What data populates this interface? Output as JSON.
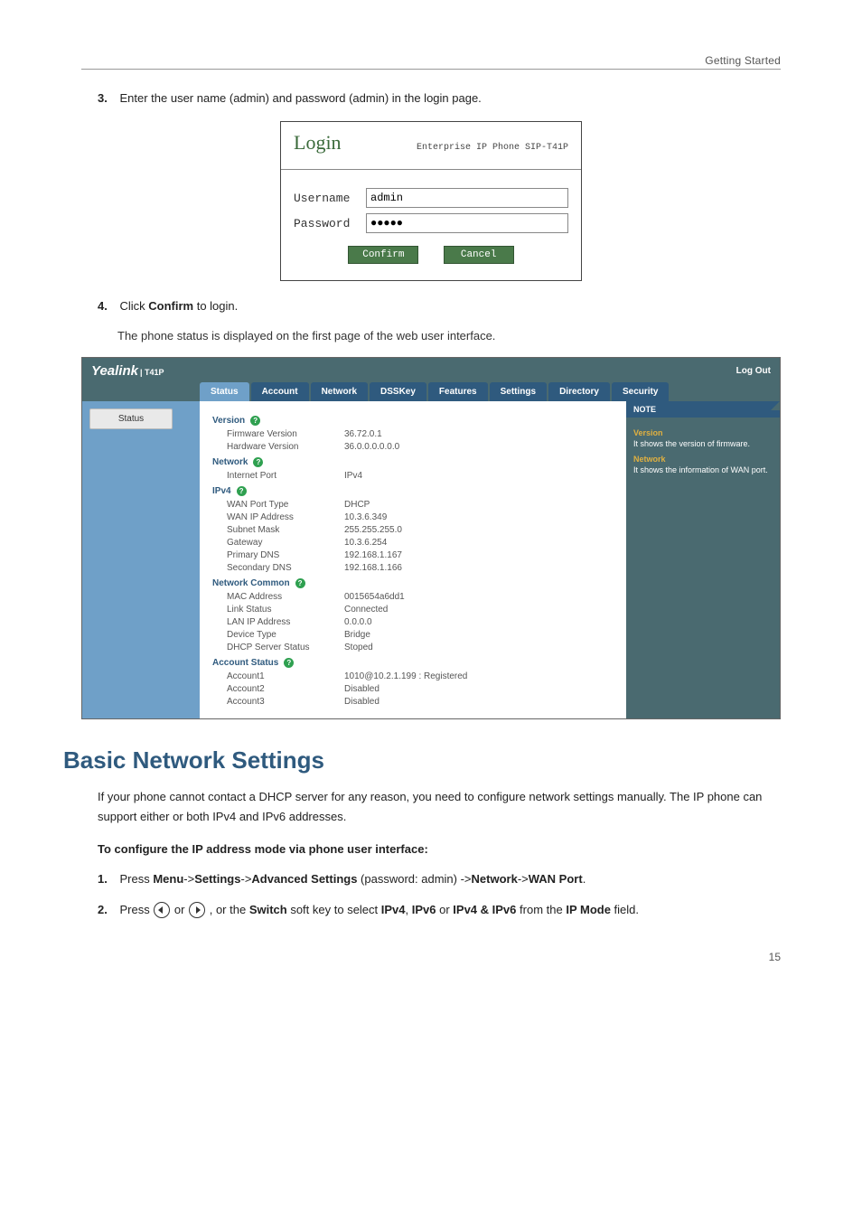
{
  "header": {
    "section": "Getting Started"
  },
  "steps": {
    "s3_num": "3.",
    "s3_text": "Enter the user name (admin) and password (admin) in the login page.",
    "s4_num": "4.",
    "s4_text_a": "Click ",
    "s4_text_b": "Confirm",
    "s4_text_c": " to login.",
    "s4_sub": "The phone status is displayed on the first page of the web user interface."
  },
  "login": {
    "title": "Login",
    "subtitle": "Enterprise IP Phone SIP-T41P",
    "username_label": "Username",
    "username_value": "admin",
    "password_label": "Password",
    "password_value": "●●●●●",
    "confirm": "Confirm",
    "cancel": "Cancel"
  },
  "webui": {
    "brand": "Yealink",
    "brand_sub": "| T41P",
    "logout": "Log Out",
    "tabs": [
      "Status",
      "Account",
      "Network",
      "DSSKey",
      "Features",
      "Settings",
      "Directory",
      "Security"
    ],
    "active_tab_index": 0,
    "side_item": "Status",
    "note_head": "NOTE",
    "notes": [
      {
        "title": "Version",
        "text": "It shows the version of firmware."
      },
      {
        "title": "Network",
        "text": "It shows the information of WAN port."
      }
    ],
    "sections": [
      {
        "title": "Version",
        "rows": [
          {
            "k": "Firmware Version",
            "v": "36.72.0.1"
          },
          {
            "k": "Hardware Version",
            "v": "36.0.0.0.0.0.0"
          }
        ]
      },
      {
        "title": "Network",
        "rows": [
          {
            "k": "Internet Port",
            "v": "IPv4"
          }
        ]
      },
      {
        "title": "IPv4",
        "rows": [
          {
            "k": "WAN Port Type",
            "v": "DHCP"
          },
          {
            "k": "WAN IP Address",
            "v": "10.3.6.349"
          },
          {
            "k": "Subnet Mask",
            "v": "255.255.255.0"
          },
          {
            "k": "Gateway",
            "v": "10.3.6.254"
          },
          {
            "k": "Primary DNS",
            "v": "192.168.1.167"
          },
          {
            "k": "Secondary DNS",
            "v": "192.168.1.166"
          }
        ]
      },
      {
        "title": "Network Common",
        "rows": [
          {
            "k": "MAC Address",
            "v": "0015654a6dd1"
          },
          {
            "k": "Link Status",
            "v": "Connected"
          },
          {
            "k": "LAN IP Address",
            "v": "0.0.0.0"
          },
          {
            "k": "Device Type",
            "v": "Bridge"
          },
          {
            "k": "DHCP Server Status",
            "v": "Stoped"
          }
        ]
      },
      {
        "title": "Account Status",
        "rows": [
          {
            "k": "Account1",
            "v": "1010@10.2.1.199 : Registered"
          },
          {
            "k": "Account2",
            "v": "Disabled"
          },
          {
            "k": "Account3",
            "v": "Disabled"
          }
        ]
      }
    ]
  },
  "heading": "Basic Network Settings",
  "para1": "If your phone cannot contact a DHCP server for any reason, you need to configure network settings manually. The IP phone can support either or both IPv4 and IPv6 addresses.",
  "para2": "To configure the IP address mode via phone user interface:",
  "step1": {
    "num": "1.",
    "a": "Press ",
    "b": "Menu",
    "c": "->",
    "d": "Settings",
    "e": "->",
    "f": "Advanced Settings",
    "g": " (password: admin) ->",
    "h": "Network",
    "i": "->",
    "j": "WAN Port",
    "k": "."
  },
  "step2": {
    "num": "2.",
    "a": "Press ",
    "b": " or ",
    "c": " , or the ",
    "d": "Switch",
    "e": " soft key to select ",
    "f": "IPv4",
    "g": ", ",
    "h": "IPv6",
    "i": " or ",
    "j": "IPv4 & IPv6",
    "k": " from the ",
    "l": "IP Mode",
    "m": " field."
  },
  "pagenum": "15"
}
